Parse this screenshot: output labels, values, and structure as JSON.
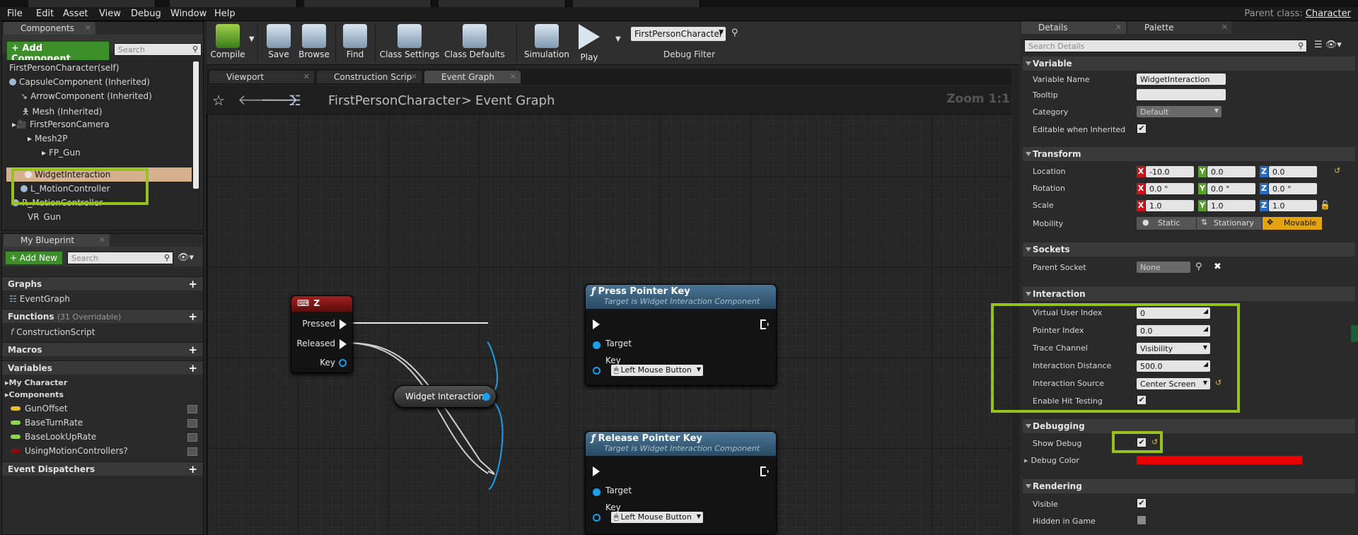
{
  "menu": [
    "File",
    "Edit",
    "Asset",
    "View",
    "Debug",
    "Window",
    "Help"
  ],
  "parent_class_label": "Parent class:",
  "parent_class_value": "Character",
  "components_panel": {
    "tab": "Components",
    "add_component": "+ Add Component",
    "search_placeholder": "Search",
    "items": [
      "FirstPersonCharacter(self)",
      "CapsuleComponent (Inherited)",
      "ArrowComponent (Inherited)",
      "Mesh (Inherited)",
      "FirstPersonCamera",
      "Mesh2P",
      "FP_Gun",
      "WidgetInteraction",
      "L_MotionController",
      "R_MotionController",
      "VR_Gun"
    ]
  },
  "blueprint_panel": {
    "tab": "My Blueprint",
    "add_new": "+ Add New",
    "search_placeholder": "Search",
    "graphs_label": "Graphs",
    "event_graph": "EventGraph",
    "functions_label": "Functions",
    "functions_count": "(31 Overridable)",
    "construction_script": "ConstructionScript",
    "macros_label": "Macros",
    "variables_label": "Variables",
    "my_character": "My Character",
    "components_label": "Components",
    "vars": [
      {
        "name": "GunOffset",
        "color": "#e5c02a"
      },
      {
        "name": "BaseTurnRate",
        "color": "#8fd64f"
      },
      {
        "name": "BaseLookUpRate",
        "color": "#8fd64f"
      },
      {
        "name": "UsingMotionControllers?",
        "color": "#8a0d0d"
      }
    ],
    "event_dispatchers": "Event Dispatchers"
  },
  "toolbar": {
    "compile": "Compile",
    "save": "Save",
    "browse": "Browse",
    "find": "Find",
    "class_settings": "Class Settings",
    "class_defaults": "Class Defaults",
    "simulation": "Simulation",
    "play": "Play",
    "debug_object": "FirstPersonCharacter",
    "debug_filter": "Debug Filter"
  },
  "graph_tabs": [
    "Viewport",
    "Construction Scrip",
    "Event Graph"
  ],
  "breadcrumb": {
    "root": "FirstPersonCharacter",
    "separator": ">",
    "current": "Event Graph"
  },
  "zoom": "Zoom 1:1",
  "nodes": {
    "z_event": {
      "title": "Z",
      "pressed": "Pressed",
      "released": "Released",
      "key": "Key"
    },
    "widget_var": {
      "label": "Widget Interaction"
    },
    "press": {
      "title": "Press Pointer Key",
      "subtitle": "Target is Widget Interaction Component",
      "target": "Target",
      "key": "Key",
      "key_value": "Left Mouse Button"
    },
    "release": {
      "title": "Release Pointer Key",
      "subtitle": "Target is Widget Interaction Component",
      "target": "Target",
      "key": "Key",
      "key_value": "Left Mouse Button"
    }
  },
  "details": {
    "tab": "Details",
    "palette_tab": "Palette",
    "search_placeholder": "Search Details",
    "variable": {
      "section": "Variable",
      "name_label": "Variable Name",
      "name_value": "WidgetInteraction",
      "tooltip_label": "Tooltip",
      "tooltip_value": "",
      "category_label": "Category",
      "category_value": "Default",
      "editable_label": "Editable when Inherited"
    },
    "transform": {
      "section": "Transform",
      "location_label": "Location",
      "location": [
        "-10.0",
        "0.0",
        "0.0"
      ],
      "rotation_label": "Rotation",
      "rotation": [
        "0.0 °",
        "0.0 °",
        "0.0 °"
      ],
      "scale_label": "Scale",
      "scale": [
        "1.0",
        "1.0",
        "1.0"
      ],
      "mobility_label": "Mobility",
      "mobility_options": [
        "Static",
        "Stationary",
        "Movable"
      ],
      "axes": [
        "X",
        "Y",
        "Z"
      ]
    },
    "sockets": {
      "section": "Sockets",
      "parent_label": "Parent Socket",
      "parent_value": "None"
    },
    "interaction": {
      "section": "Interaction",
      "rows": [
        {
          "label": "Virtual User Index",
          "value": "0"
        },
        {
          "label": "Pointer Index",
          "value": "0.0"
        },
        {
          "label": "Trace Channel",
          "value": "Visibility"
        },
        {
          "label": "Interaction Distance",
          "value": "500.0"
        },
        {
          "label": "Interaction Source",
          "value": "Center Screen"
        }
      ],
      "hit_testing_label": "Enable Hit Testing"
    },
    "debugging": {
      "section": "Debugging",
      "show_label": "Show Debug",
      "color_label": "Debug Color",
      "color": "#e60000"
    },
    "rendering": {
      "section": "Rendering",
      "visible_label": "Visible",
      "hidden_label": "Hidden in Game"
    }
  },
  "colors": {
    "highlight": "#97c11c",
    "accent_blue": "#1a9fe8",
    "movable": "#e3a40d"
  }
}
